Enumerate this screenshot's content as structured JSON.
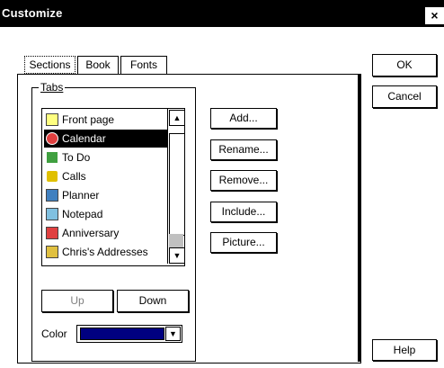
{
  "window": {
    "title": "Customize",
    "close_glyph": "×"
  },
  "tabs": [
    {
      "label": "Sections",
      "active": true
    },
    {
      "label": "Book",
      "active": false
    },
    {
      "label": "Fonts",
      "active": false
    }
  ],
  "tabs_group": {
    "label": "Tabs"
  },
  "list_items": [
    {
      "label": "Front page",
      "icon": "front-page-icon",
      "icon_color": "#ffff80",
      "selected": false
    },
    {
      "label": "Calendar",
      "icon": "calendar-icon",
      "icon_color": "#e04040",
      "selected": true
    },
    {
      "label": "To Do",
      "icon": "todo-check-icon",
      "icon_color": "#40a040",
      "selected": false
    },
    {
      "label": "Calls",
      "icon": "phone-icon",
      "icon_color": "#e0c000",
      "selected": false
    },
    {
      "label": "Planner",
      "icon": "planner-icon",
      "icon_color": "#4080c0",
      "selected": false
    },
    {
      "label": "Notepad",
      "icon": "notepad-icon",
      "icon_color": "#80c0e0",
      "selected": false
    },
    {
      "label": "Anniversary",
      "icon": "anniversary-icon",
      "icon_color": "#e04040",
      "selected": false
    },
    {
      "label": "Chris's Addresses",
      "icon": "address-book-icon",
      "icon_color": "#e0c040",
      "selected": false
    }
  ],
  "action_buttons": {
    "add": "Add...",
    "rename": "Rename...",
    "remove": "Remove...",
    "include": "Include...",
    "picture": "Picture..."
  },
  "order_buttons": {
    "up": "Up",
    "down": "Down"
  },
  "color": {
    "label": "Color",
    "value_hex": "#000080"
  },
  "dialog_buttons": {
    "ok": "OK",
    "cancel": "Cancel",
    "help": "Help"
  }
}
